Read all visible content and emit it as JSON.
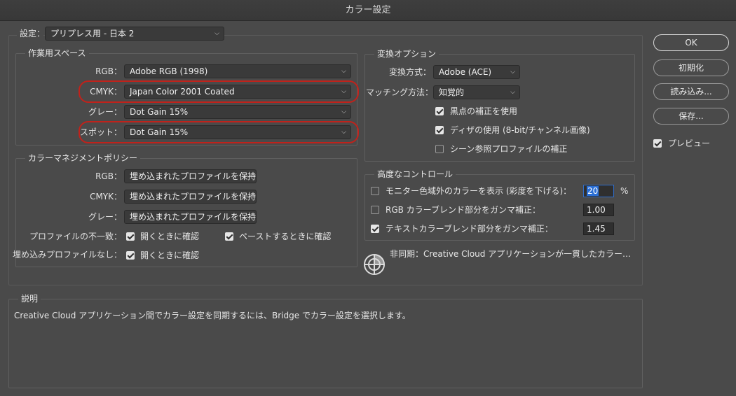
{
  "window": {
    "title": "カラー設定"
  },
  "settings": {
    "label": "設定：",
    "value": "プリプレス用 - 日本 2"
  },
  "working_spaces": {
    "title": "作業用スペース",
    "rgb_label": "RGB：",
    "rgb_value": "Adobe RGB (1998)",
    "cmyk_label": "CMYK：",
    "cmyk_value": "Japan Color 2001 Coated",
    "gray_label": "グレー：",
    "gray_value": "Dot Gain 15%",
    "spot_label": "スポット：",
    "spot_value": "Dot Gain 15%"
  },
  "policies": {
    "title": "カラーマネジメントポリシー",
    "rgb_label": "RGB：",
    "rgb_value": "埋め込まれたプロファイルを保持",
    "cmyk_label": "CMYK：",
    "cmyk_value": "埋め込まれたプロファイルを保持",
    "gray_label": "グレー：",
    "gray_value": "埋め込まれたプロファイルを保持",
    "mismatch_label": "プロファイルの不一致：",
    "mismatch_open": {
      "label": "開くときに確認",
      "checked": true
    },
    "mismatch_paste": {
      "label": "ペーストするときに確認",
      "checked": true
    },
    "missing_label": "埋め込みプロファイルなし：",
    "missing_open": {
      "label": "開くときに確認",
      "checked": true
    }
  },
  "conversion": {
    "title": "変換オプション",
    "engine_label": "変換方式：",
    "engine_value": "Adobe (ACE)",
    "intent_label": "マッチング方法：",
    "intent_value": "知覚的",
    "black_point": {
      "label": "黒点の補正を使用",
      "checked": true
    },
    "dither": {
      "label": "ディザの使用 (8-bit/チャンネル画像)",
      "checked": true
    },
    "scene_ref": {
      "label": "シーン参照プロファイルの補正",
      "checked": false
    }
  },
  "advanced": {
    "title": "高度なコントロール",
    "desaturate": {
      "label": "モニター色域外のカラーを表示 (彩度を下げる)：",
      "checked": false,
      "value": "20",
      "unit": "%"
    },
    "blend_rgb": {
      "label": "RGB カラーブレンド部分をガンマ補正：",
      "checked": false,
      "value": "1.00"
    },
    "blend_text": {
      "label": "テキストカラーブレンド部分をガンマ補正：",
      "checked": true,
      "value": "1.45"
    }
  },
  "sync": {
    "text": "非同期：Creative Cloud アプリケーションが一貫したカラー設定に同…",
    "icon": "sync-status-icon"
  },
  "description": {
    "title": "説明",
    "text": "Creative Cloud アプリケーション間でカラー設定を同期するには、Bridge でカラー設定を選択します。"
  },
  "buttons": {
    "ok": "OK",
    "reset": "初期化",
    "load": "読み込み...",
    "save": "保存..."
  },
  "preview": {
    "label": "プレビュー",
    "checked": true
  },
  "colors": {
    "background": "#4a4a4a",
    "highlight_ring": "#c0221b",
    "focus": "#2a6fd6"
  }
}
